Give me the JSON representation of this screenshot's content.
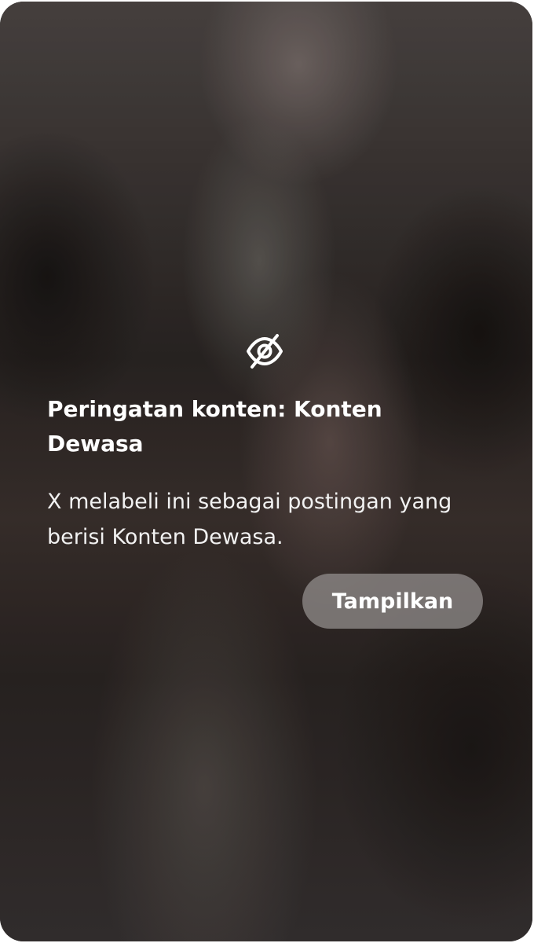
{
  "warning": {
    "icon": "eye-slash-icon",
    "title": "Peringatan konten: Konten Dewasa",
    "description": "X melabeli ini sebagai postingan yang berisi Konten Dewasa.",
    "show_button_label": "Tampilkan"
  },
  "colors": {
    "text": "#ffffff",
    "button_background": "#968f8e"
  }
}
